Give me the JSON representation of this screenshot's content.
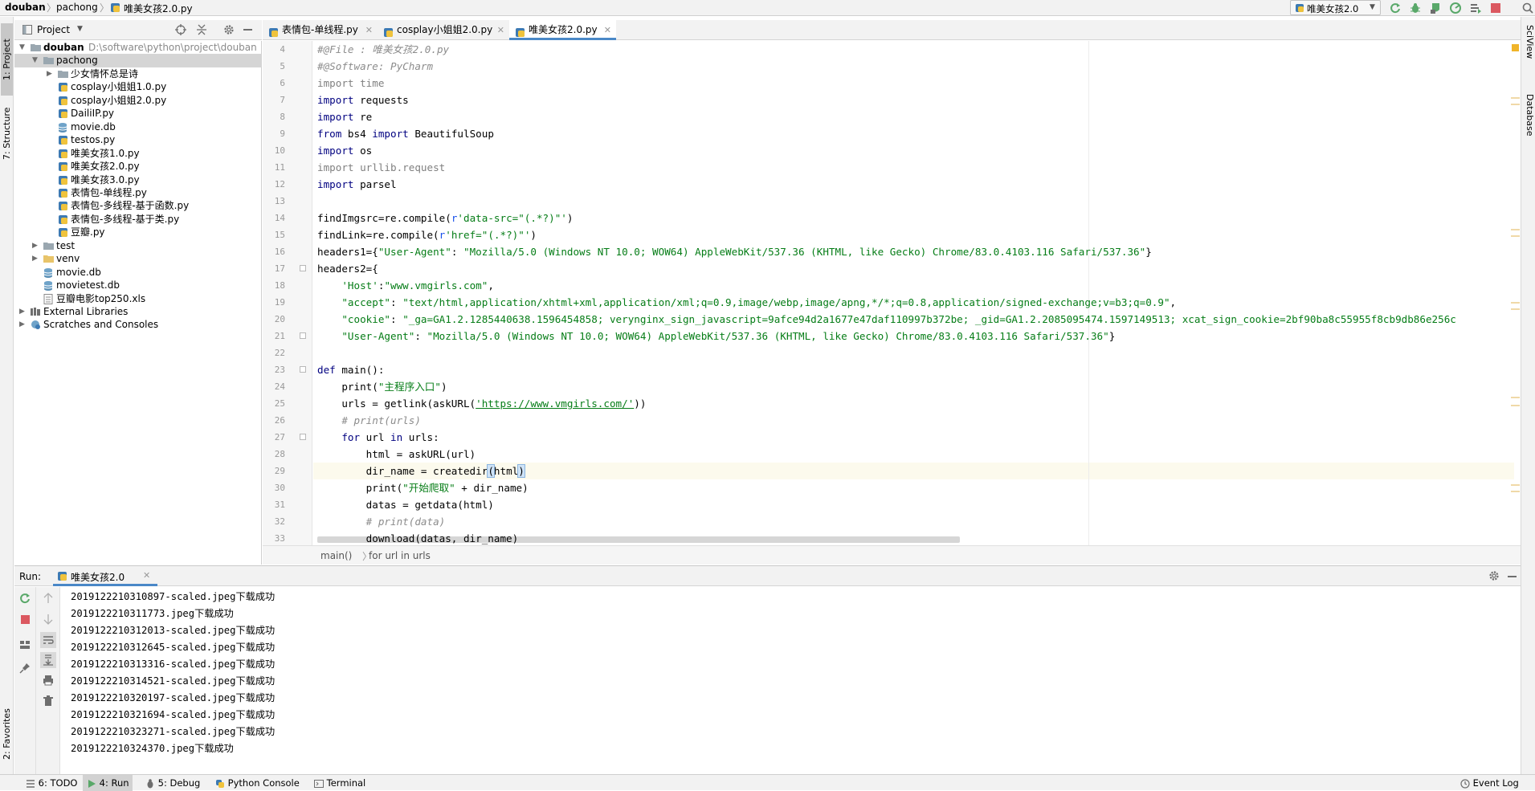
{
  "breadcrumb": {
    "project": "douban",
    "folder": "pachong",
    "file": "唯美女孩2.0.py"
  },
  "toolbar": {
    "run_config": "唯美女孩2.0",
    "colors": {
      "run": "#59a869",
      "debug": "#59a869",
      "stop": "#db5860"
    }
  },
  "left_stripe": {
    "project": "1: Project",
    "structure": "7: Structure",
    "favorites": "2: Favorites"
  },
  "right_stripe": {
    "sciview": "SciView",
    "database": "Database"
  },
  "project_panel": {
    "title": "Project",
    "tree": [
      {
        "label": "douban",
        "path": "D:\\software\\python\\project\\douban",
        "type": "folder",
        "depth": 0,
        "expanded": true
      },
      {
        "label": "pachong",
        "type": "folder",
        "depth": 1,
        "expanded": true,
        "selected": true
      },
      {
        "label": "少女情怀总是诗",
        "type": "folder",
        "depth": 2,
        "expanded": false
      },
      {
        "label": "cosplay小姐姐1.0.py",
        "type": "py",
        "depth": 2
      },
      {
        "label": "cosplay小姐姐2.0.py",
        "type": "py",
        "depth": 2
      },
      {
        "label": "DailiIP.py",
        "type": "py",
        "depth": 2
      },
      {
        "label": "movie.db",
        "type": "db",
        "depth": 2
      },
      {
        "label": "testos.py",
        "type": "py",
        "depth": 2
      },
      {
        "label": "唯美女孩1.0.py",
        "type": "py",
        "depth": 2
      },
      {
        "label": "唯美女孩2.0.py",
        "type": "py",
        "depth": 2
      },
      {
        "label": "唯美女孩3.0.py",
        "type": "py",
        "depth": 2
      },
      {
        "label": "表情包-单线程.py",
        "type": "py",
        "depth": 2
      },
      {
        "label": "表情包-多线程-基于函数.py",
        "type": "py",
        "depth": 2
      },
      {
        "label": "表情包-多线程-基于类.py",
        "type": "py",
        "depth": 2
      },
      {
        "label": "豆瓣.py",
        "type": "py",
        "depth": 2
      },
      {
        "label": "test",
        "type": "folder",
        "depth": 1,
        "expanded": false
      },
      {
        "label": "venv",
        "type": "folder-venv",
        "depth": 1,
        "expanded": false
      },
      {
        "label": "movie.db",
        "type": "db",
        "depth": 1
      },
      {
        "label": "movietest.db",
        "type": "db",
        "depth": 1
      },
      {
        "label": "豆瓣电影top250.xls",
        "type": "xls",
        "depth": 1
      },
      {
        "label": "External Libraries",
        "type": "lib",
        "depth": 0,
        "expanded": false
      },
      {
        "label": "Scratches and Consoles",
        "type": "scratch",
        "depth": 0,
        "expanded": false
      }
    ]
  },
  "editor_tabs": [
    {
      "label": "表情包-单线程.py",
      "active": false
    },
    {
      "label": "cosplay小姐姐2.0.py",
      "active": false
    },
    {
      "label": "唯美女孩2.0.py",
      "active": true
    }
  ],
  "line_numbers": [
    "4",
    "5",
    "6",
    "7",
    "8",
    "9",
    "10",
    "11",
    "12",
    "13",
    "14",
    "15",
    "16",
    "17",
    "18",
    "19",
    "20",
    "21",
    "22",
    "23",
    "24",
    "25",
    "26",
    "27",
    "28",
    "29",
    "30",
    "31",
    "32",
    "33"
  ],
  "code_lines": [
    [
      {
        "t": "#@File : 唯美女孩2.0.py",
        "c": "cmt"
      }
    ],
    [
      {
        "t": "#@Software: PyCharm",
        "c": "cmt"
      }
    ],
    [
      {
        "t": "import",
        "c": "grey"
      },
      {
        "t": " time",
        "c": "grey"
      }
    ],
    [
      {
        "t": "import",
        "c": "kwn"
      },
      {
        "t": " requests",
        "c": ""
      }
    ],
    [
      {
        "t": "import",
        "c": "kwn"
      },
      {
        "t": " re",
        "c": ""
      }
    ],
    [
      {
        "t": "from",
        "c": "kwn"
      },
      {
        "t": " bs4 ",
        "c": ""
      },
      {
        "t": "import",
        "c": "kwn"
      },
      {
        "t": " BeautifulSoup",
        "c": ""
      }
    ],
    [
      {
        "t": "import",
        "c": "kwn"
      },
      {
        "t": " os",
        "c": ""
      }
    ],
    [
      {
        "t": "import",
        "c": "grey"
      },
      {
        "t": " urllib.request",
        "c": "grey"
      }
    ],
    [
      {
        "t": "import",
        "c": "kwn"
      },
      {
        "t": " parsel",
        "c": ""
      }
    ],
    [],
    [
      {
        "t": "findImgsrc=re.compile(",
        "c": ""
      },
      {
        "t": "r",
        "c": "pre"
      },
      {
        "t": "'data-src=\"(.*?)\"'",
        "c": "str"
      },
      {
        "t": ")",
        "c": ""
      }
    ],
    [
      {
        "t": "findLink=re.compile(",
        "c": ""
      },
      {
        "t": "r",
        "c": "pre"
      },
      {
        "t": "'href=\"(.*?)\"'",
        "c": "str"
      },
      {
        "t": ")",
        "c": ""
      }
    ],
    [
      {
        "t": "headers1={",
        "c": ""
      },
      {
        "t": "\"User-Agent\"",
        "c": "str"
      },
      {
        "t": ": ",
        "c": ""
      },
      {
        "t": "\"Mozilla/5.0 (Windows NT 10.0; WOW64) AppleWebKit/537.36 (KHTML, like Gecko) Chrome/83.0.4103.116 Safari/537.36\"",
        "c": "str"
      },
      {
        "t": "}",
        "c": ""
      }
    ],
    [
      {
        "t": "headers2={",
        "c": ""
      }
    ],
    [
      {
        "t": "    ",
        "c": ""
      },
      {
        "t": "'Host'",
        "c": "str"
      },
      {
        "t": ":",
        "c": ""
      },
      {
        "t": "\"www.vmgirls.com\"",
        "c": "str"
      },
      {
        "t": ",",
        "c": ""
      }
    ],
    [
      {
        "t": "    ",
        "c": ""
      },
      {
        "t": "\"accept\"",
        "c": "str"
      },
      {
        "t": ": ",
        "c": ""
      },
      {
        "t": "\"text/html,application/xhtml+xml,application/xml;q=0.9,image/webp,image/apng,*/*;q=0.8,application/signed-exchange;v=b3;q=0.9\"",
        "c": "str"
      },
      {
        "t": ",",
        "c": ""
      }
    ],
    [
      {
        "t": "    ",
        "c": ""
      },
      {
        "t": "\"cookie\"",
        "c": "str"
      },
      {
        "t": ": ",
        "c": ""
      },
      {
        "t": "\"_ga=GA1.2.1285440638.1596454858; verynginx_sign_javascript=9afce94d2a1677e47daf110997b372be; _gid=GA1.2.2085095474.1597149513; xcat_sign_cookie=2bf90ba8c55955f8cb9db86e256c",
        "c": "str"
      }
    ],
    [
      {
        "t": "    ",
        "c": ""
      },
      {
        "t": "\"User-Agent\"",
        "c": "str"
      },
      {
        "t": ": ",
        "c": ""
      },
      {
        "t": "\"Mozilla/5.0 (Windows NT 10.0; WOW64) AppleWebKit/537.36 (KHTML, like Gecko) Chrome/83.0.4103.116 Safari/537.36\"",
        "c": "str"
      },
      {
        "t": "}",
        "c": ""
      }
    ],
    [],
    [
      {
        "t": "def",
        "c": "kwn"
      },
      {
        "t": " main():",
        "c": ""
      }
    ],
    [
      {
        "t": "    print(",
        "c": ""
      },
      {
        "t": "\"主程序入口\"",
        "c": "str"
      },
      {
        "t": ")",
        "c": ""
      }
    ],
    [
      {
        "t": "    urls = getlink(askURL(",
        "c": ""
      },
      {
        "t": "'https://www.vmgirls.com/'",
        "c": "url"
      },
      {
        "t": "))",
        "c": ""
      }
    ],
    [
      {
        "t": "    ",
        "c": ""
      },
      {
        "t": "# print(urls)",
        "c": "cmt"
      }
    ],
    [
      {
        "t": "    ",
        "c": ""
      },
      {
        "t": "for",
        "c": "kwn"
      },
      {
        "t": " url ",
        "c": ""
      },
      {
        "t": "in",
        "c": "kwn"
      },
      {
        "t": " urls:",
        "c": ""
      }
    ],
    [
      {
        "t": "        html = askURL(url)",
        "c": ""
      }
    ],
    [
      {
        "t": "        dir_name = createdir",
        "c": ""
      },
      {
        "t": "(",
        "c": "mark"
      },
      {
        "t": "html",
        "c": ""
      },
      {
        "t": ")",
        "c": "mark"
      }
    ],
    [
      {
        "t": "        print(",
        "c": ""
      },
      {
        "t": "\"开始爬取\"",
        "c": "str"
      },
      {
        "t": " + dir_name)",
        "c": ""
      }
    ],
    [
      {
        "t": "        datas = getdata(html)",
        "c": ""
      }
    ],
    [
      {
        "t": "        ",
        "c": ""
      },
      {
        "t": "# print(data)",
        "c": "cmt"
      }
    ],
    [
      {
        "t": "        download(datas, dir_name)",
        "c": ""
      }
    ]
  ],
  "editor_breadcrumb": {
    "func": "main()",
    "loop": "for url in urls"
  },
  "run_panel": {
    "label": "Run:",
    "tab": "唯美女孩2.0",
    "output": [
      "2019122210310897-scaled.jpeg下载成功",
      "2019122210311773.jpeg下载成功",
      "2019122210312013-scaled.jpeg下载成功",
      "2019122210312645-scaled.jpeg下载成功",
      "2019122210313316-scaled.jpeg下载成功",
      "2019122210314521-scaled.jpeg下载成功",
      "2019122210320197-scaled.jpeg下载成功",
      "2019122210321694-scaled.jpeg下载成功",
      "2019122210323271-scaled.jpeg下载成功",
      "2019122210324370.jpeg下载成功"
    ]
  },
  "bottom_tabs": [
    {
      "label": "6: TODO",
      "icon": "list-icon",
      "active": false
    },
    {
      "label": "4: Run",
      "icon": "play-icon",
      "active": true
    },
    {
      "label": "5: Debug",
      "icon": "bug-icon",
      "active": false
    },
    {
      "label": "Python Console",
      "icon": "python-icon",
      "active": false
    },
    {
      "label": "Terminal",
      "icon": "terminal-icon",
      "active": false
    }
  ],
  "event_log": "Event Log"
}
